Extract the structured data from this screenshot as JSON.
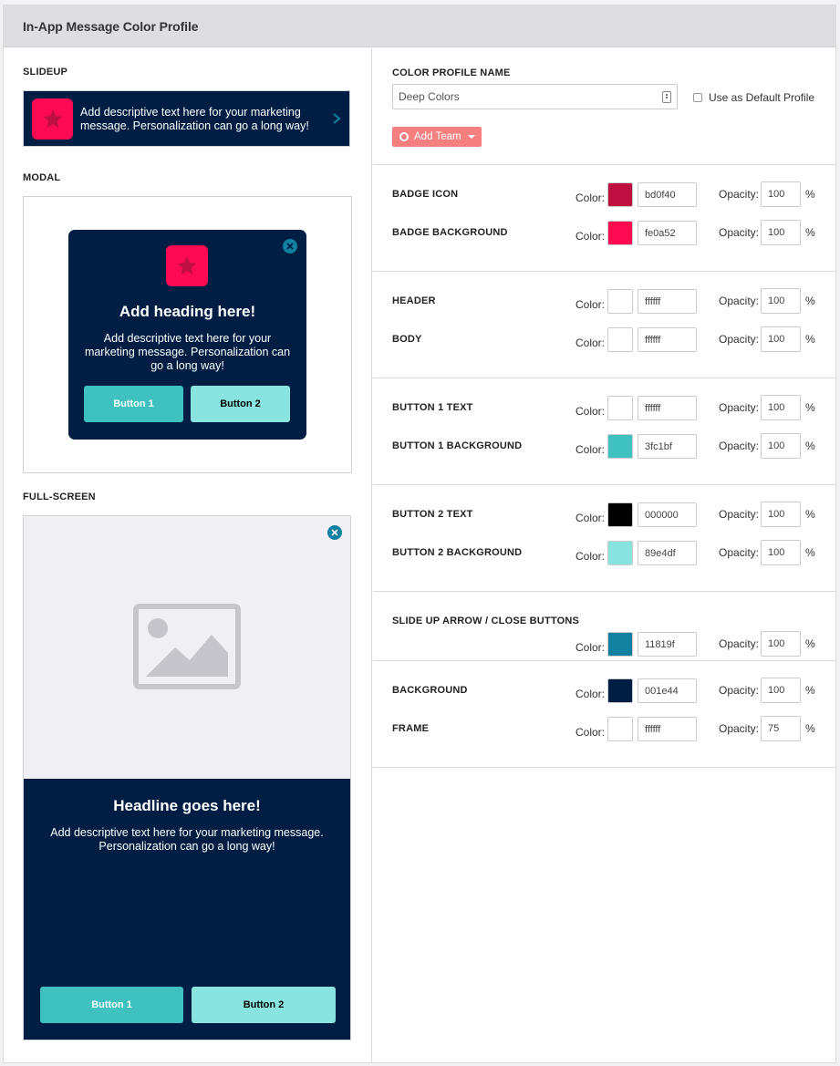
{
  "panel": {
    "title": "In-App Message Color Profile"
  },
  "left": {
    "slideup_label": "SLIDEUP",
    "modal_label": "MODAL",
    "fullscreen_label": "FULL-SCREEN",
    "slideup": {
      "text": "Add descriptive text here for your marketing message. Personalization can go a long way!"
    },
    "modal": {
      "heading": "Add heading here!",
      "body": "Add descriptive text here for your marketing message. Personalization can go a long way!",
      "button1": "Button 1",
      "button2": "Button 2"
    },
    "fullscreen": {
      "heading": "Headline goes here!",
      "body": "Add descriptive text here for your marketing message. Personalization can go a long way!",
      "button1": "Button 1",
      "button2": "Button 2"
    }
  },
  "right": {
    "profile_name_label": "COLOR PROFILE NAME",
    "profile_name_value": "Deep Colors",
    "default_label": "Use as Default Profile",
    "add_team_label": "Add Team",
    "color_label": "Color:",
    "opacity_label": "Opacity:",
    "percent": "%",
    "rows": [
      {
        "label": "BADGE ICON",
        "hex": "bd0f40",
        "color": "#bd0f40",
        "opacity": "100"
      },
      {
        "label": "BADGE BACKGROUND",
        "hex": "fe0a52",
        "color": "#fe0a52",
        "opacity": "100"
      },
      {
        "label": "HEADER",
        "hex": "ffffff",
        "color": "#ffffff",
        "opacity": "100"
      },
      {
        "label": "BODY",
        "hex": "ffffff",
        "color": "#ffffff",
        "opacity": "100"
      },
      {
        "label": "BUTTON 1 TEXT",
        "hex": "ffffff",
        "color": "#ffffff",
        "opacity": "100"
      },
      {
        "label": "BUTTON 1 BACKGROUND",
        "hex": "3fc1bf",
        "color": "#3fc1bf",
        "opacity": "100"
      },
      {
        "label": "BUTTON 2 TEXT",
        "hex": "000000",
        "color": "#000000",
        "opacity": "100"
      },
      {
        "label": "BUTTON 2 BACKGROUND",
        "hex": "89e4df",
        "color": "#89e4df",
        "opacity": "100"
      },
      {
        "label": "SLIDE UP ARROW / CLOSE BUTTONS",
        "hex": "11819f",
        "color": "#11819f",
        "opacity": "100"
      },
      {
        "label": "BACKGROUND",
        "hex": "001e44",
        "color": "#001e44",
        "opacity": "100"
      },
      {
        "label": "FRAME",
        "hex": "ffffff",
        "color": "#ffffff",
        "opacity": "75"
      }
    ]
  }
}
